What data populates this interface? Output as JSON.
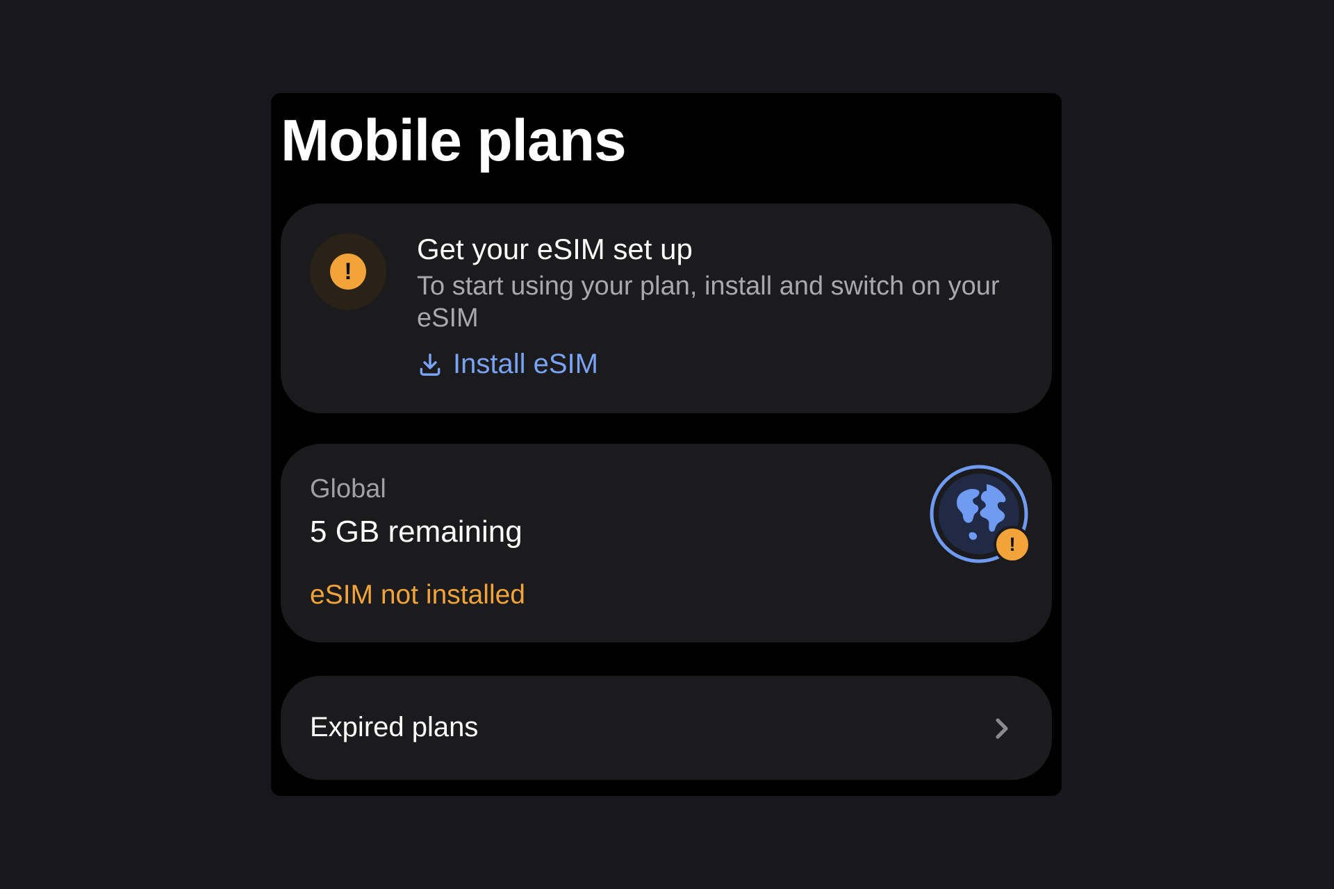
{
  "page": {
    "title": "Mobile plans"
  },
  "colors": {
    "warning": "#f2a33a",
    "link": "#7aa3f5",
    "globe_blue": "#6f9cf2"
  },
  "esim_setup": {
    "icon": "warning-icon",
    "icon_glyph": "!",
    "title": "Get your eSIM set up",
    "body": "To start using your plan, install and switch on your eSIM",
    "action_icon": "download-icon",
    "action_label": "Install eSIM"
  },
  "plan": {
    "label": "Global",
    "remaining": "5 GB remaining",
    "status": "eSIM not installed",
    "icon": "globe-icon",
    "badge_icon": "warning-badge-icon",
    "badge_glyph": "!"
  },
  "expired": {
    "label": "Expired plans",
    "icon": "chevron-right-icon"
  }
}
